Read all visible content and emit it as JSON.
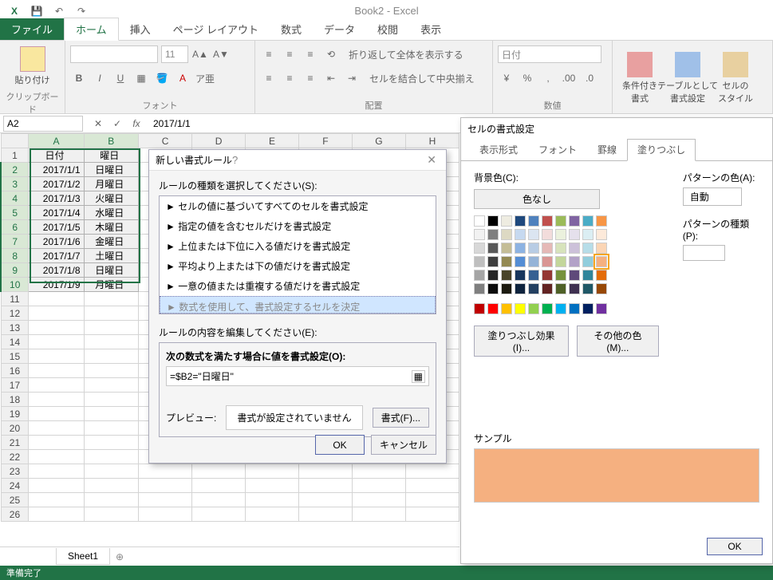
{
  "app": {
    "title": "Book2 - Excel"
  },
  "qat": {
    "save": "💾",
    "undo": "↶",
    "redo": "↷"
  },
  "tabs": {
    "file": "ファイル",
    "items": [
      "ホーム",
      "挿入",
      "ページ レイアウト",
      "数式",
      "データ",
      "校閲",
      "表示"
    ],
    "active": "ホーム"
  },
  "ribbon": {
    "clipboard": {
      "paste": "貼り付け",
      "label": "クリップボード"
    },
    "font": {
      "name": "",
      "size": "11",
      "label": "フォント",
      "bold": "B",
      "italic": "I",
      "underline": "U"
    },
    "align": {
      "label": "配置",
      "wrap": "折り返して全体を表示する",
      "merge": "セルを結合して中央揃え"
    },
    "number": {
      "label": "数値",
      "format": "日付",
      "percent": "%"
    },
    "styles": {
      "cond": "条件付き\n書式",
      "table": "テーブルとして\n書式設定",
      "cell": "セルの\nスタイル"
    }
  },
  "formula": {
    "cellref": "A2",
    "value": "2017/1/1",
    "fx": "fx"
  },
  "sheet": {
    "cols": [
      "A",
      "B",
      "C",
      "D",
      "E"
    ],
    "rowcount": 26,
    "headers": [
      "日付",
      "曜日"
    ],
    "rows": [
      [
        "2017/1/1",
        "日曜日"
      ],
      [
        "2017/1/2",
        "月曜日"
      ],
      [
        "2017/1/3",
        "火曜日"
      ],
      [
        "2017/1/4",
        "水曜日"
      ],
      [
        "2017/1/5",
        "木曜日"
      ],
      [
        "2017/1/6",
        "金曜日"
      ],
      [
        "2017/1/7",
        "土曜日"
      ],
      [
        "2017/1/8",
        "日曜日"
      ],
      [
        "2017/1/9",
        "月曜日"
      ]
    ],
    "tab": "Sheet1",
    "status": "準備完了"
  },
  "dlg_rule": {
    "title": "新しい書式ルール",
    "sect1_label": "ルールの種類を選択してください(S):",
    "rule_types": [
      "► セルの値に基づいてすべてのセルを書式設定",
      "► 指定の値を含むセルだけを書式設定",
      "► 上位または下位に入る値だけを書式設定",
      "► 平均より上または下の値だけを書式設定",
      "► 一意の値または重複する値だけを書式設定",
      "► 数式を使用して、書式設定するセルを決定"
    ],
    "sect2_label": "ルールの内容を編集してください(E):",
    "formula_label": "次の数式を満たす場合に値を書式設定(O):",
    "formula_value": "=$B2=\"日曜日\"",
    "preview_label": "プレビュー:",
    "preview_text": "書式が設定されていません",
    "format_btn": "書式(F)...",
    "ok": "OK",
    "cancel": "キャンセル"
  },
  "dlg_format": {
    "title": "セルの書式設定",
    "tabs": [
      "表示形式",
      "フォント",
      "罫線",
      "塗りつぶし"
    ],
    "active_tab": "塗りつぶし",
    "bgcolor_label": "背景色(C):",
    "no_color": "色なし",
    "pattern_color_label": "パターンの色(A):",
    "pattern_color_auto": "自動",
    "pattern_type_label": "パターンの種類(P):",
    "fill_effects": "塗りつぶし効果(I)...",
    "other_colors": "その他の色(M)...",
    "sample_label": "サンプル",
    "sample_color": "#f5b080",
    "ok": "OK",
    "palette_rows": [
      [
        "#ffffff",
        "#000000",
        "#eeece1",
        "#1f497d",
        "#4f81bd",
        "#c0504d",
        "#9bbb59",
        "#8064a2",
        "#4bacc6",
        "#f79646"
      ],
      [
        "#f2f2f2",
        "#7f7f7f",
        "#ddd9c3",
        "#c6d9f0",
        "#dbe5f1",
        "#f2dcdb",
        "#ebf1dd",
        "#e5e0ec",
        "#dbeef3",
        "#fdeada"
      ],
      [
        "#d8d8d8",
        "#595959",
        "#c4bd97",
        "#8db3e2",
        "#b8cce4",
        "#e5b9b7",
        "#d7e3bc",
        "#ccc1d9",
        "#b7dde8",
        "#fbd5b5"
      ],
      [
        "#bfbfbf",
        "#3f3f3f",
        "#938953",
        "#548dd4",
        "#95b3d7",
        "#d99694",
        "#c3d69b",
        "#b2a2c7",
        "#92cddc",
        "#f5b080"
      ],
      [
        "#a5a5a5",
        "#262626",
        "#494429",
        "#17365d",
        "#366092",
        "#953734",
        "#76923c",
        "#5f497a",
        "#31859b",
        "#e36c09"
      ],
      [
        "#7f7f7f",
        "#0c0c0c",
        "#1d1b10",
        "#0f243e",
        "#244061",
        "#632423",
        "#4f6128",
        "#3f3151",
        "#205867",
        "#974806"
      ]
    ],
    "standard_row": [
      "#c00000",
      "#ff0000",
      "#ffc000",
      "#ffff00",
      "#92d050",
      "#00b050",
      "#00b0f0",
      "#0070c0",
      "#002060",
      "#7030a0"
    ]
  }
}
